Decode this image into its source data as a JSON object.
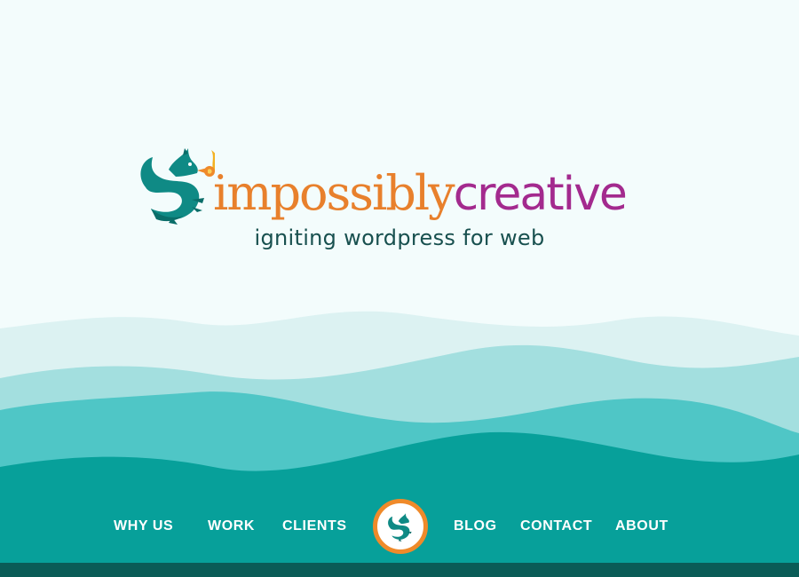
{
  "brand": {
    "word_impossibly": "impossibly",
    "word_creative": "creative",
    "tagline": "igniting wordpress for web",
    "logo_icon": "dragon-icon",
    "colors": {
      "orange": "#e8802c",
      "purple": "#a32a8e",
      "teal": "#0f8a85",
      "tagline": "#18504f"
    }
  },
  "nav": {
    "items": [
      {
        "label": "WHY US"
      },
      {
        "label": "WORK"
      },
      {
        "label": "CLIENTS"
      },
      {
        "label": "BLOG"
      },
      {
        "label": "CONTACT"
      },
      {
        "label": "ABOUT"
      }
    ],
    "center_icon": "dragon-icon"
  },
  "waves": {
    "colors": [
      "#dcf2f2",
      "#a3dfdf",
      "#4fc6c6",
      "#07a09a"
    ]
  }
}
